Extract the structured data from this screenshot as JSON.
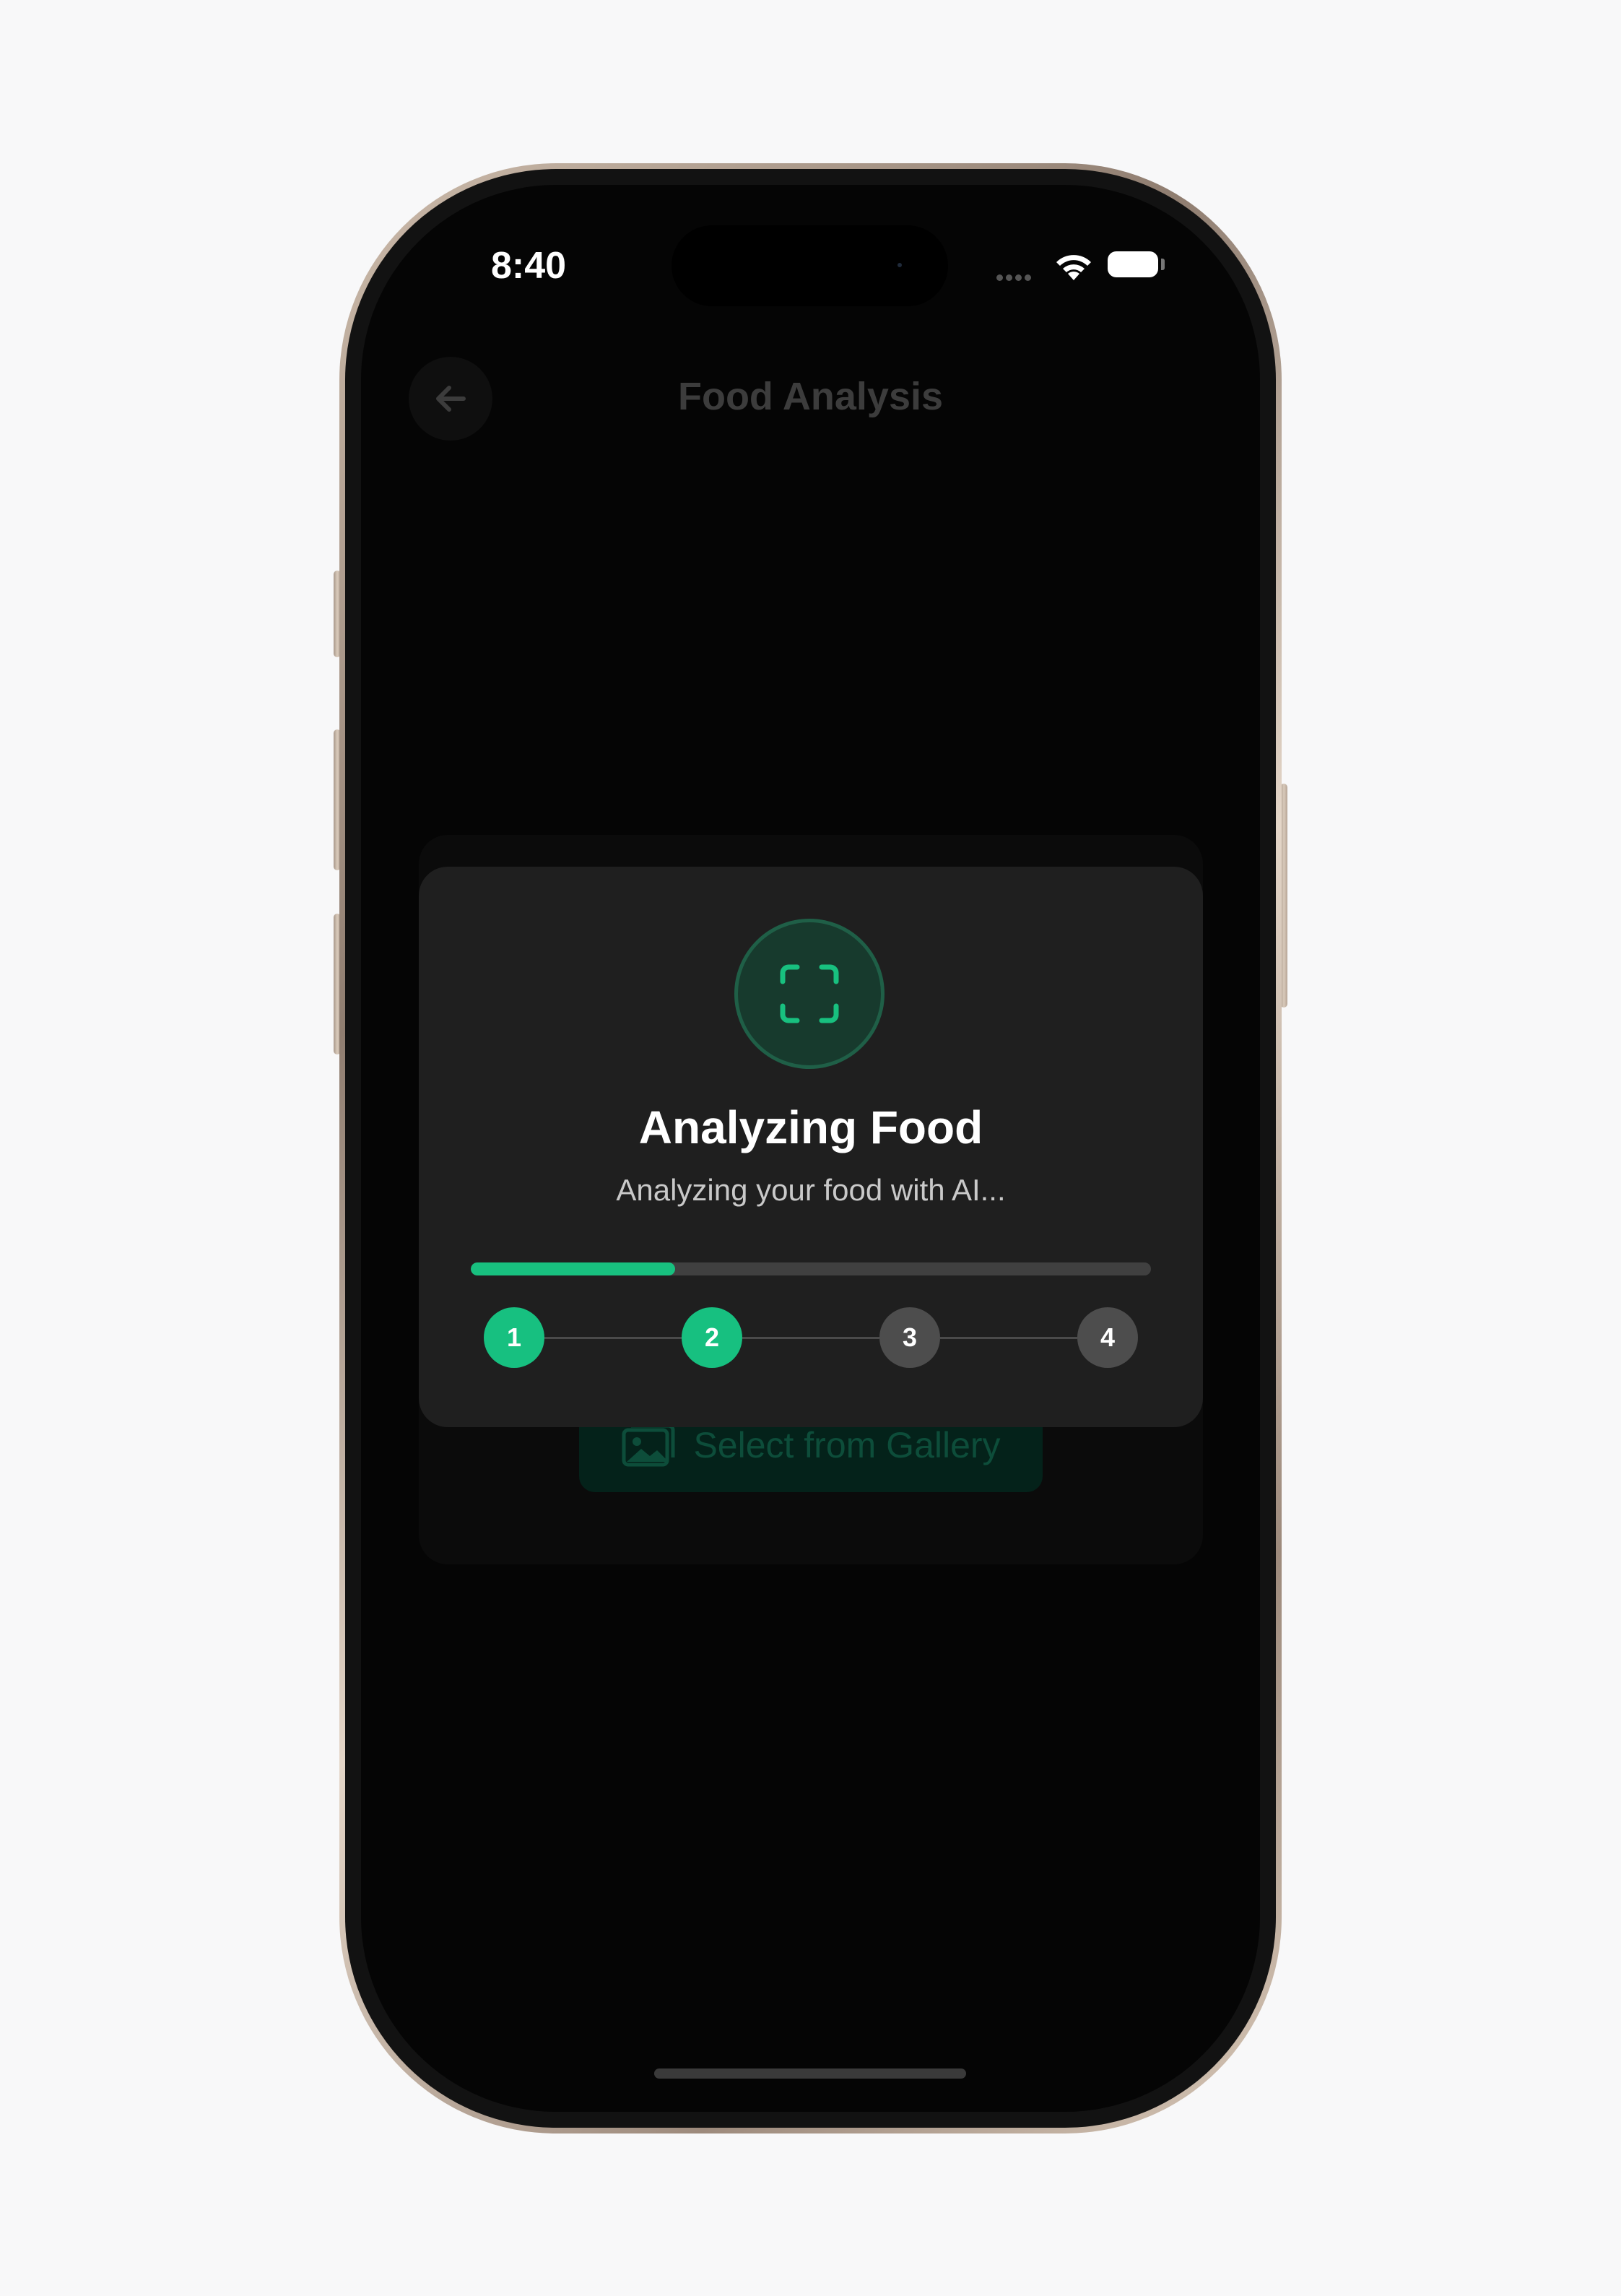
{
  "status_bar": {
    "time": "8:40"
  },
  "header": {
    "title": "Food Analysis",
    "back_icon": "arrow-left-icon"
  },
  "background": {
    "gallery_button_label": "Select from Gallery",
    "gallery_icon": "image-gallery-icon"
  },
  "modal": {
    "icon": "scan-frame-icon",
    "title": "Analyzing Food",
    "subtitle": "Analyzing your food with AI...",
    "progress_fraction": 0.3,
    "steps": [
      {
        "label": "1",
        "state": "active"
      },
      {
        "label": "2",
        "state": "active"
      },
      {
        "label": "3",
        "state": "pending"
      },
      {
        "label": "4",
        "state": "pending"
      }
    ]
  },
  "colors": {
    "accent": "#18c07f",
    "modal_bg": "#1f1f1f",
    "screen_bg": "#050505"
  }
}
